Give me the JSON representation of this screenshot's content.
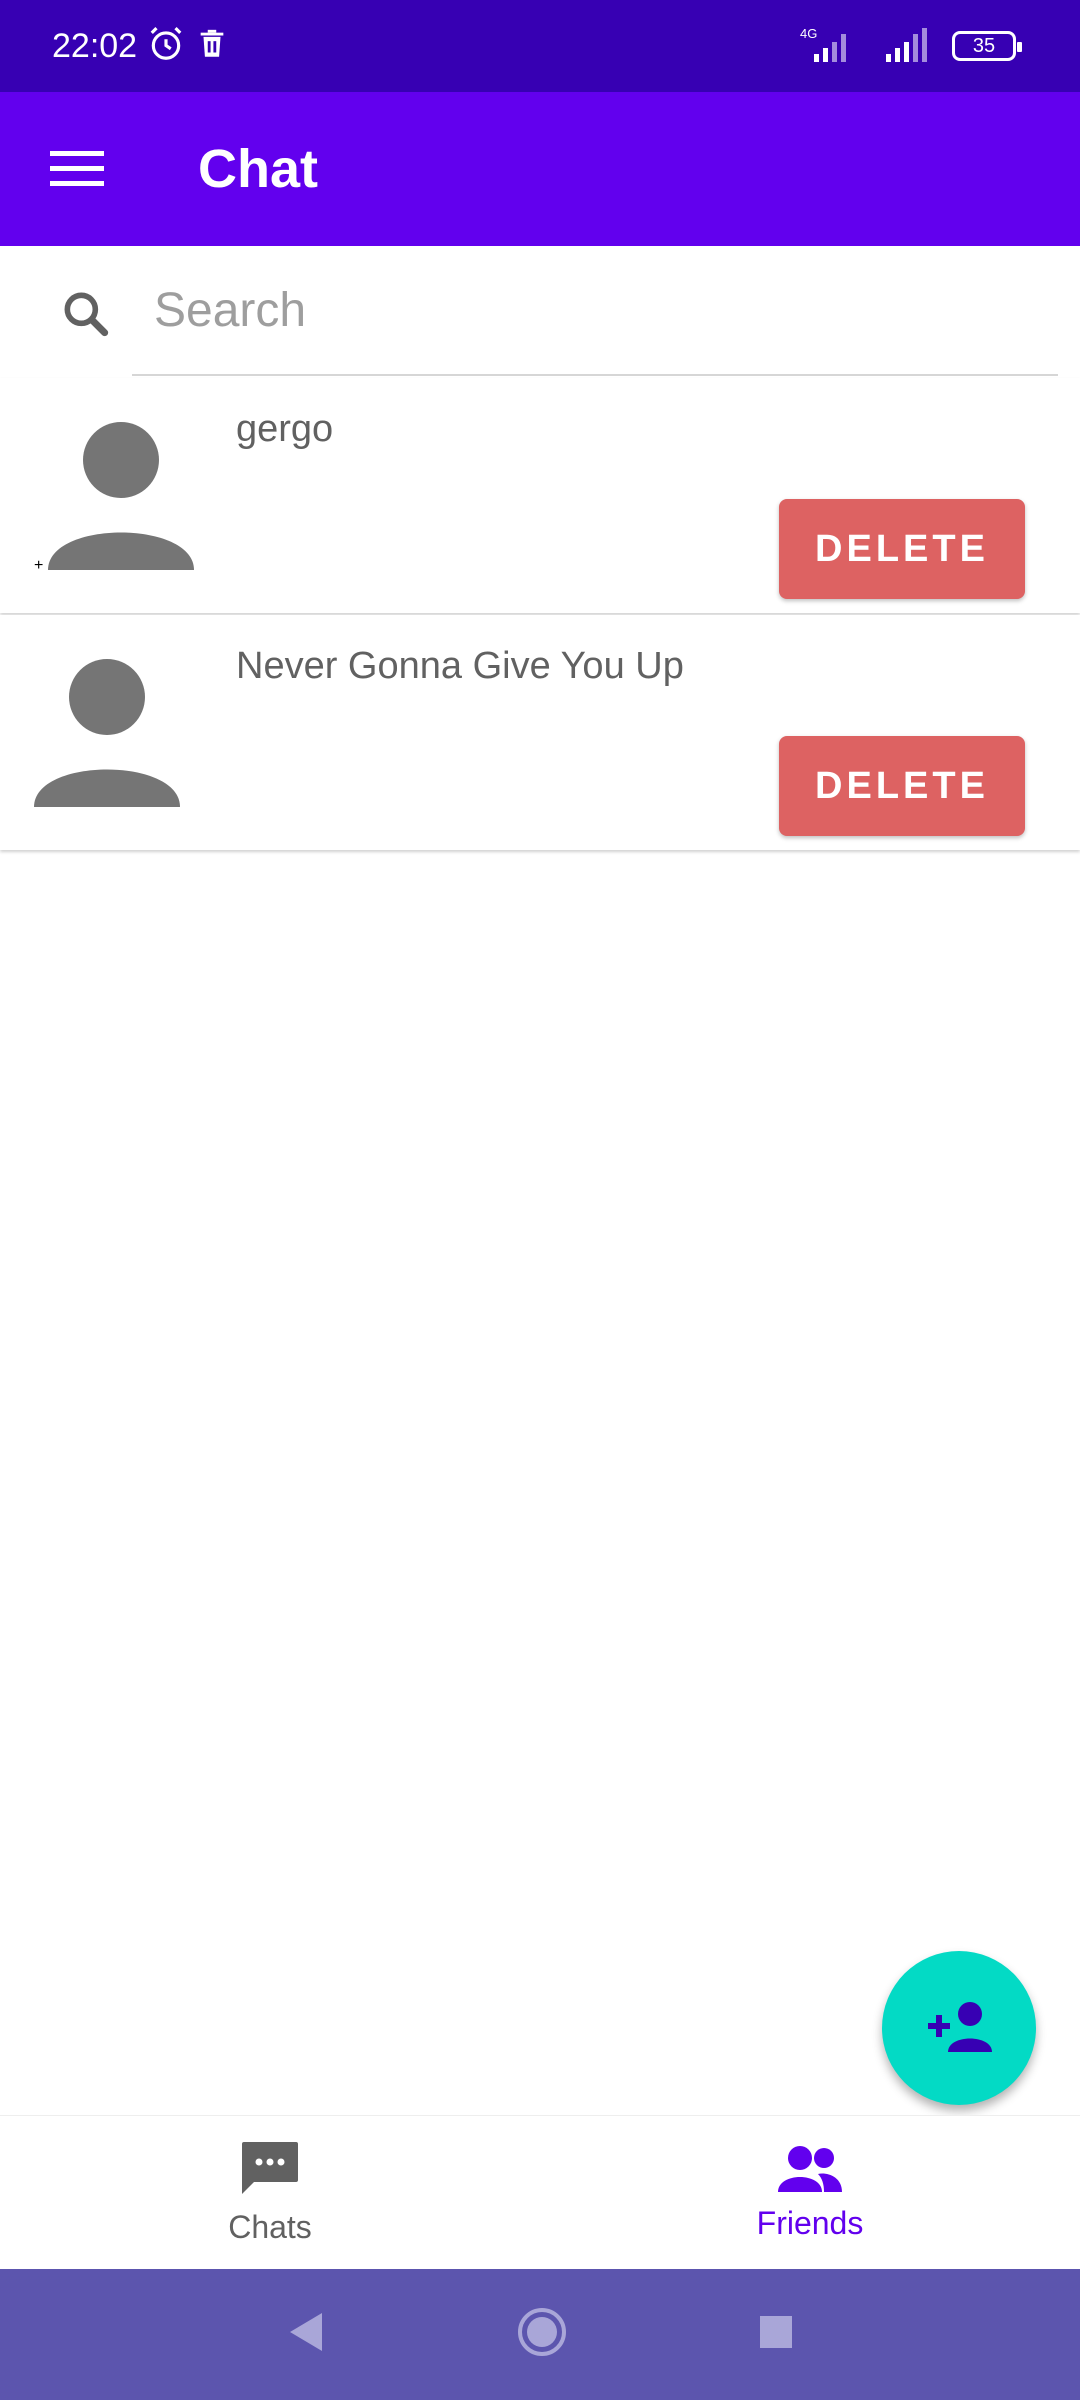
{
  "status_bar": {
    "time": "22:02",
    "network_label": "4G",
    "battery": "35",
    "icons": [
      "alarm-icon",
      "trash-notification-icon",
      "signal-icon",
      "signal-icon",
      "battery-icon"
    ]
  },
  "app_bar": {
    "title": "Chat",
    "menu_icon": "hamburger-menu-icon"
  },
  "search": {
    "placeholder": "Search",
    "value": "",
    "icon": "search-icon"
  },
  "friends": [
    {
      "name": "gergo",
      "delete_label": "DELETE"
    },
    {
      "name": "Never Gonna Give You Up",
      "delete_label": "DELETE"
    }
  ],
  "fab": {
    "icon": "add-person-icon"
  },
  "bottom_nav": {
    "items": [
      {
        "label": "Chats",
        "icon": "chat-bubble-icon",
        "active": false
      },
      {
        "label": "Friends",
        "icon": "people-icon",
        "active": true
      }
    ]
  },
  "system_nav": {
    "icons": [
      "back-icon",
      "home-icon",
      "recents-icon"
    ]
  },
  "colors": {
    "status_bar": "#3700b3",
    "primary": "#6200ee",
    "delete": "#dd6262",
    "fab": "#03dac5",
    "system_nav": "#5c55ae"
  }
}
